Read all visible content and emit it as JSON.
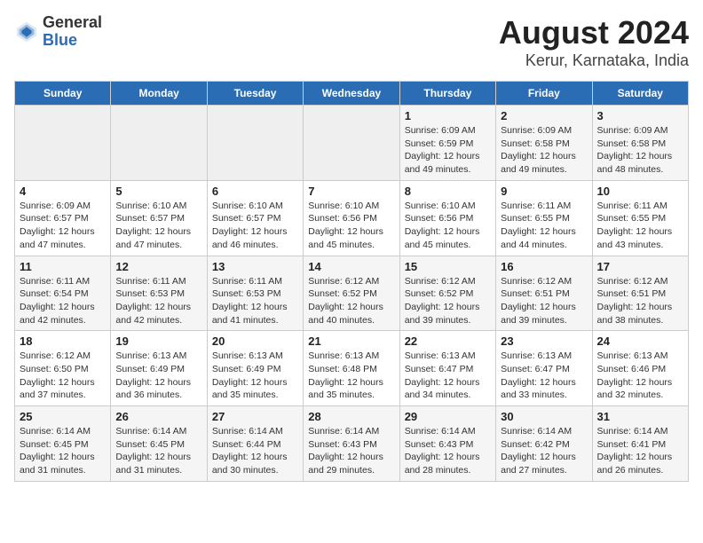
{
  "header": {
    "logo_general": "General",
    "logo_blue": "Blue",
    "main_title": "August 2024",
    "subtitle": "Kerur, Karnataka, India"
  },
  "calendar": {
    "days_of_week": [
      "Sunday",
      "Monday",
      "Tuesday",
      "Wednesday",
      "Thursday",
      "Friday",
      "Saturday"
    ],
    "weeks": [
      [
        {
          "day": "",
          "info": ""
        },
        {
          "day": "",
          "info": ""
        },
        {
          "day": "",
          "info": ""
        },
        {
          "day": "",
          "info": ""
        },
        {
          "day": "1",
          "info": "Sunrise: 6:09 AM\nSunset: 6:59 PM\nDaylight: 12 hours\nand 49 minutes."
        },
        {
          "day": "2",
          "info": "Sunrise: 6:09 AM\nSunset: 6:58 PM\nDaylight: 12 hours\nand 49 minutes."
        },
        {
          "day": "3",
          "info": "Sunrise: 6:09 AM\nSunset: 6:58 PM\nDaylight: 12 hours\nand 48 minutes."
        }
      ],
      [
        {
          "day": "4",
          "info": "Sunrise: 6:09 AM\nSunset: 6:57 PM\nDaylight: 12 hours\nand 47 minutes."
        },
        {
          "day": "5",
          "info": "Sunrise: 6:10 AM\nSunset: 6:57 PM\nDaylight: 12 hours\nand 47 minutes."
        },
        {
          "day": "6",
          "info": "Sunrise: 6:10 AM\nSunset: 6:57 PM\nDaylight: 12 hours\nand 46 minutes."
        },
        {
          "day": "7",
          "info": "Sunrise: 6:10 AM\nSunset: 6:56 PM\nDaylight: 12 hours\nand 45 minutes."
        },
        {
          "day": "8",
          "info": "Sunrise: 6:10 AM\nSunset: 6:56 PM\nDaylight: 12 hours\nand 45 minutes."
        },
        {
          "day": "9",
          "info": "Sunrise: 6:11 AM\nSunset: 6:55 PM\nDaylight: 12 hours\nand 44 minutes."
        },
        {
          "day": "10",
          "info": "Sunrise: 6:11 AM\nSunset: 6:55 PM\nDaylight: 12 hours\nand 43 minutes."
        }
      ],
      [
        {
          "day": "11",
          "info": "Sunrise: 6:11 AM\nSunset: 6:54 PM\nDaylight: 12 hours\nand 42 minutes."
        },
        {
          "day": "12",
          "info": "Sunrise: 6:11 AM\nSunset: 6:53 PM\nDaylight: 12 hours\nand 42 minutes."
        },
        {
          "day": "13",
          "info": "Sunrise: 6:11 AM\nSunset: 6:53 PM\nDaylight: 12 hours\nand 41 minutes."
        },
        {
          "day": "14",
          "info": "Sunrise: 6:12 AM\nSunset: 6:52 PM\nDaylight: 12 hours\nand 40 minutes."
        },
        {
          "day": "15",
          "info": "Sunrise: 6:12 AM\nSunset: 6:52 PM\nDaylight: 12 hours\nand 39 minutes."
        },
        {
          "day": "16",
          "info": "Sunrise: 6:12 AM\nSunset: 6:51 PM\nDaylight: 12 hours\nand 39 minutes."
        },
        {
          "day": "17",
          "info": "Sunrise: 6:12 AM\nSunset: 6:51 PM\nDaylight: 12 hours\nand 38 minutes."
        }
      ],
      [
        {
          "day": "18",
          "info": "Sunrise: 6:12 AM\nSunset: 6:50 PM\nDaylight: 12 hours\nand 37 minutes."
        },
        {
          "day": "19",
          "info": "Sunrise: 6:13 AM\nSunset: 6:49 PM\nDaylight: 12 hours\nand 36 minutes."
        },
        {
          "day": "20",
          "info": "Sunrise: 6:13 AM\nSunset: 6:49 PM\nDaylight: 12 hours\nand 35 minutes."
        },
        {
          "day": "21",
          "info": "Sunrise: 6:13 AM\nSunset: 6:48 PM\nDaylight: 12 hours\nand 35 minutes."
        },
        {
          "day": "22",
          "info": "Sunrise: 6:13 AM\nSunset: 6:47 PM\nDaylight: 12 hours\nand 34 minutes."
        },
        {
          "day": "23",
          "info": "Sunrise: 6:13 AM\nSunset: 6:47 PM\nDaylight: 12 hours\nand 33 minutes."
        },
        {
          "day": "24",
          "info": "Sunrise: 6:13 AM\nSunset: 6:46 PM\nDaylight: 12 hours\nand 32 minutes."
        }
      ],
      [
        {
          "day": "25",
          "info": "Sunrise: 6:14 AM\nSunset: 6:45 PM\nDaylight: 12 hours\nand 31 minutes."
        },
        {
          "day": "26",
          "info": "Sunrise: 6:14 AM\nSunset: 6:45 PM\nDaylight: 12 hours\nand 31 minutes."
        },
        {
          "day": "27",
          "info": "Sunrise: 6:14 AM\nSunset: 6:44 PM\nDaylight: 12 hours\nand 30 minutes."
        },
        {
          "day": "28",
          "info": "Sunrise: 6:14 AM\nSunset: 6:43 PM\nDaylight: 12 hours\nand 29 minutes."
        },
        {
          "day": "29",
          "info": "Sunrise: 6:14 AM\nSunset: 6:43 PM\nDaylight: 12 hours\nand 28 minutes."
        },
        {
          "day": "30",
          "info": "Sunrise: 6:14 AM\nSunset: 6:42 PM\nDaylight: 12 hours\nand 27 minutes."
        },
        {
          "day": "31",
          "info": "Sunrise: 6:14 AM\nSunset: 6:41 PM\nDaylight: 12 hours\nand 26 minutes."
        }
      ]
    ]
  }
}
